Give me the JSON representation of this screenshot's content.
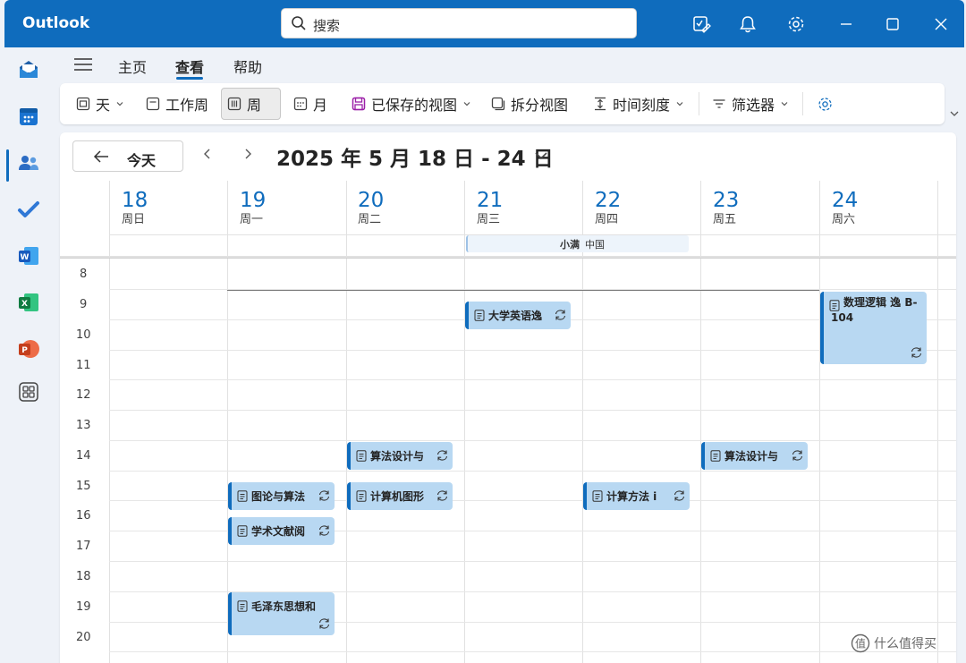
{
  "app": {
    "name": "Outlook"
  },
  "search": {
    "placeholder": "搜索"
  },
  "menu": {
    "tabs": [
      "主页",
      "查看",
      "帮助"
    ],
    "active": "查看"
  },
  "ribbon": {
    "day": "天",
    "work_week": "工作周",
    "week": "周",
    "month": "月",
    "saved_views": "已保存的视图",
    "split_view": "拆分视图",
    "time_scale": "时间刻度",
    "filter": "筛选器"
  },
  "calendar": {
    "today_label": "今天",
    "range_label": "2025 年 5 月 18 日 - 24 日",
    "days": [
      {
        "num": "18",
        "name": "周日"
      },
      {
        "num": "19",
        "name": "周一"
      },
      {
        "num": "20",
        "name": "周二"
      },
      {
        "num": "21",
        "name": "周三"
      },
      {
        "num": "22",
        "name": "周四"
      },
      {
        "num": "23",
        "name": "周五"
      },
      {
        "num": "24",
        "name": "周六"
      }
    ],
    "all_day_event": {
      "title": "小满",
      "subtitle": "中国"
    },
    "hours": [
      "8",
      "9",
      "10",
      "11",
      "12",
      "13",
      "14",
      "15",
      "16",
      "17",
      "18",
      "19",
      "20"
    ],
    "events": [
      {
        "title": "大学英语逸"
      },
      {
        "title": "数理逻辑 逸 B-104"
      },
      {
        "title": "算法设计与"
      },
      {
        "title": "算法设计与"
      },
      {
        "title": "图论与算法"
      },
      {
        "title": "计算机图形"
      },
      {
        "title": "计算方法 i"
      },
      {
        "title": "学术文献阅"
      },
      {
        "title": "毛泽东思想和"
      }
    ]
  },
  "watermark": {
    "text": "什么值得买"
  },
  "colors": {
    "brand": "#0f6cbd",
    "event_fill": "#b8d8f2"
  }
}
